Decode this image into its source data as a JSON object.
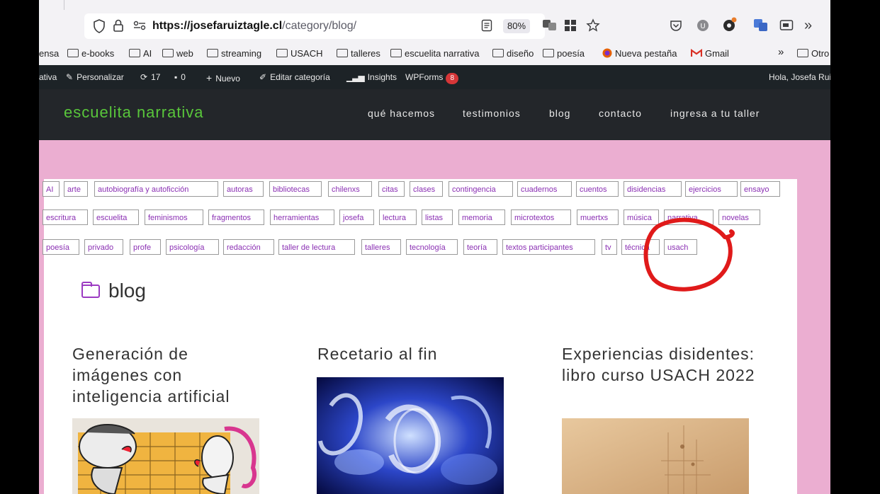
{
  "browser": {
    "url_host": "https://josefaruiztagle.cl",
    "url_path": "/category/blog/",
    "zoom": "80%",
    "icons": [
      "shield-icon",
      "lock-icon",
      "permissions-icon",
      "reader-view-icon",
      "translate-icon",
      "extensions-grid-icon",
      "star-icon",
      "pocket-icon",
      "account-icon",
      "extension-icon",
      "translate-ext-icon",
      "picture-in-picture-icon",
      "overflow-icon"
    ]
  },
  "bookmarks": {
    "items": [
      "ensa",
      "e-books",
      "AI",
      "web",
      "streaming",
      "USACH",
      "talleres",
      "escuelita narrativa",
      "diseño",
      "poesía",
      "Nueva pestaña",
      "Gmail"
    ],
    "overflow": "»",
    "other": "Otro"
  },
  "adminbar": {
    "site": "ativa",
    "customize": "Personalizar",
    "updates": "17",
    "comments": "0",
    "new": "Nuevo",
    "edit_category": "Editar categoría",
    "insights": "Insights",
    "wpforms": "WPForms",
    "wpforms_count": "8",
    "greeting": "Hola, Josefa Rui"
  },
  "site": {
    "title": "escuelita narrativa",
    "nav": [
      "qué hacemos",
      "testimonios",
      "blog",
      "contacto",
      "ingresa a tu taller"
    ]
  },
  "tags": {
    "row1": [
      "AI",
      "arte",
      "autobiografía y autoficción",
      "autoras",
      "bibliotecas",
      "chilenxs",
      "citas",
      "clases",
      "contingencia",
      "cuadernos",
      "cuentos",
      "disidencias",
      "ejercicios",
      "ensayo"
    ],
    "row2": [
      "escritura",
      "escuelita",
      "feminismos",
      "fragmentos",
      "herramientas",
      "josefa",
      "lectura",
      "listas",
      "memoria",
      "microtextos",
      "muertxs",
      "música",
      "narrativa",
      "novelas"
    ],
    "row3": [
      "poesía",
      "privado",
      "profe",
      "psicología",
      "redacción",
      "taller de lectura",
      "talleres",
      "tecnología",
      "teoría",
      "textos participantes",
      "tv",
      "técnica",
      "usach"
    ]
  },
  "page": {
    "heading": "blog"
  },
  "posts": [
    {
      "title": "Generación de imágenes con inteligencia artificial"
    },
    {
      "title": "Recetario al fin"
    },
    {
      "title": "Experiencias disidentes: libro curso USACH 2022"
    }
  ],
  "colors": {
    "pink": "#ebaed1",
    "header": "#23262a",
    "site_title": "#59c63b",
    "tag_text": "#8a2fb3",
    "annotation": "#e01a1a"
  }
}
